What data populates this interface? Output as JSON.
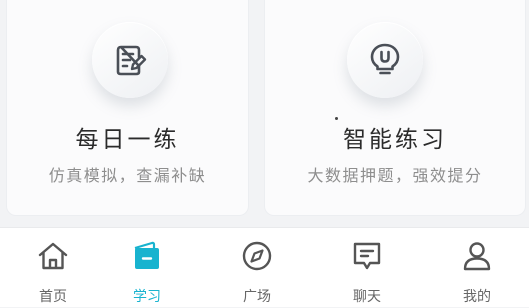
{
  "cards": [
    {
      "title": "每日一练",
      "subtitle": "仿真模拟，查漏补缺",
      "icon": "edit-note-icon"
    },
    {
      "title": "智能练习",
      "subtitle": "大数据押题，强效提分",
      "icon": "lightbulb-icon"
    }
  ],
  "tabbar": {
    "active_color": "#18b3cf",
    "items": [
      {
        "label": "首页",
        "icon": "home-icon",
        "active": false
      },
      {
        "label": "学习",
        "icon": "book-icon",
        "active": true
      },
      {
        "label": "广场",
        "icon": "compass-icon",
        "active": false
      },
      {
        "label": "聊天",
        "icon": "chat-icon",
        "active": false
      },
      {
        "label": "我的",
        "icon": "user-icon",
        "active": false
      }
    ]
  }
}
